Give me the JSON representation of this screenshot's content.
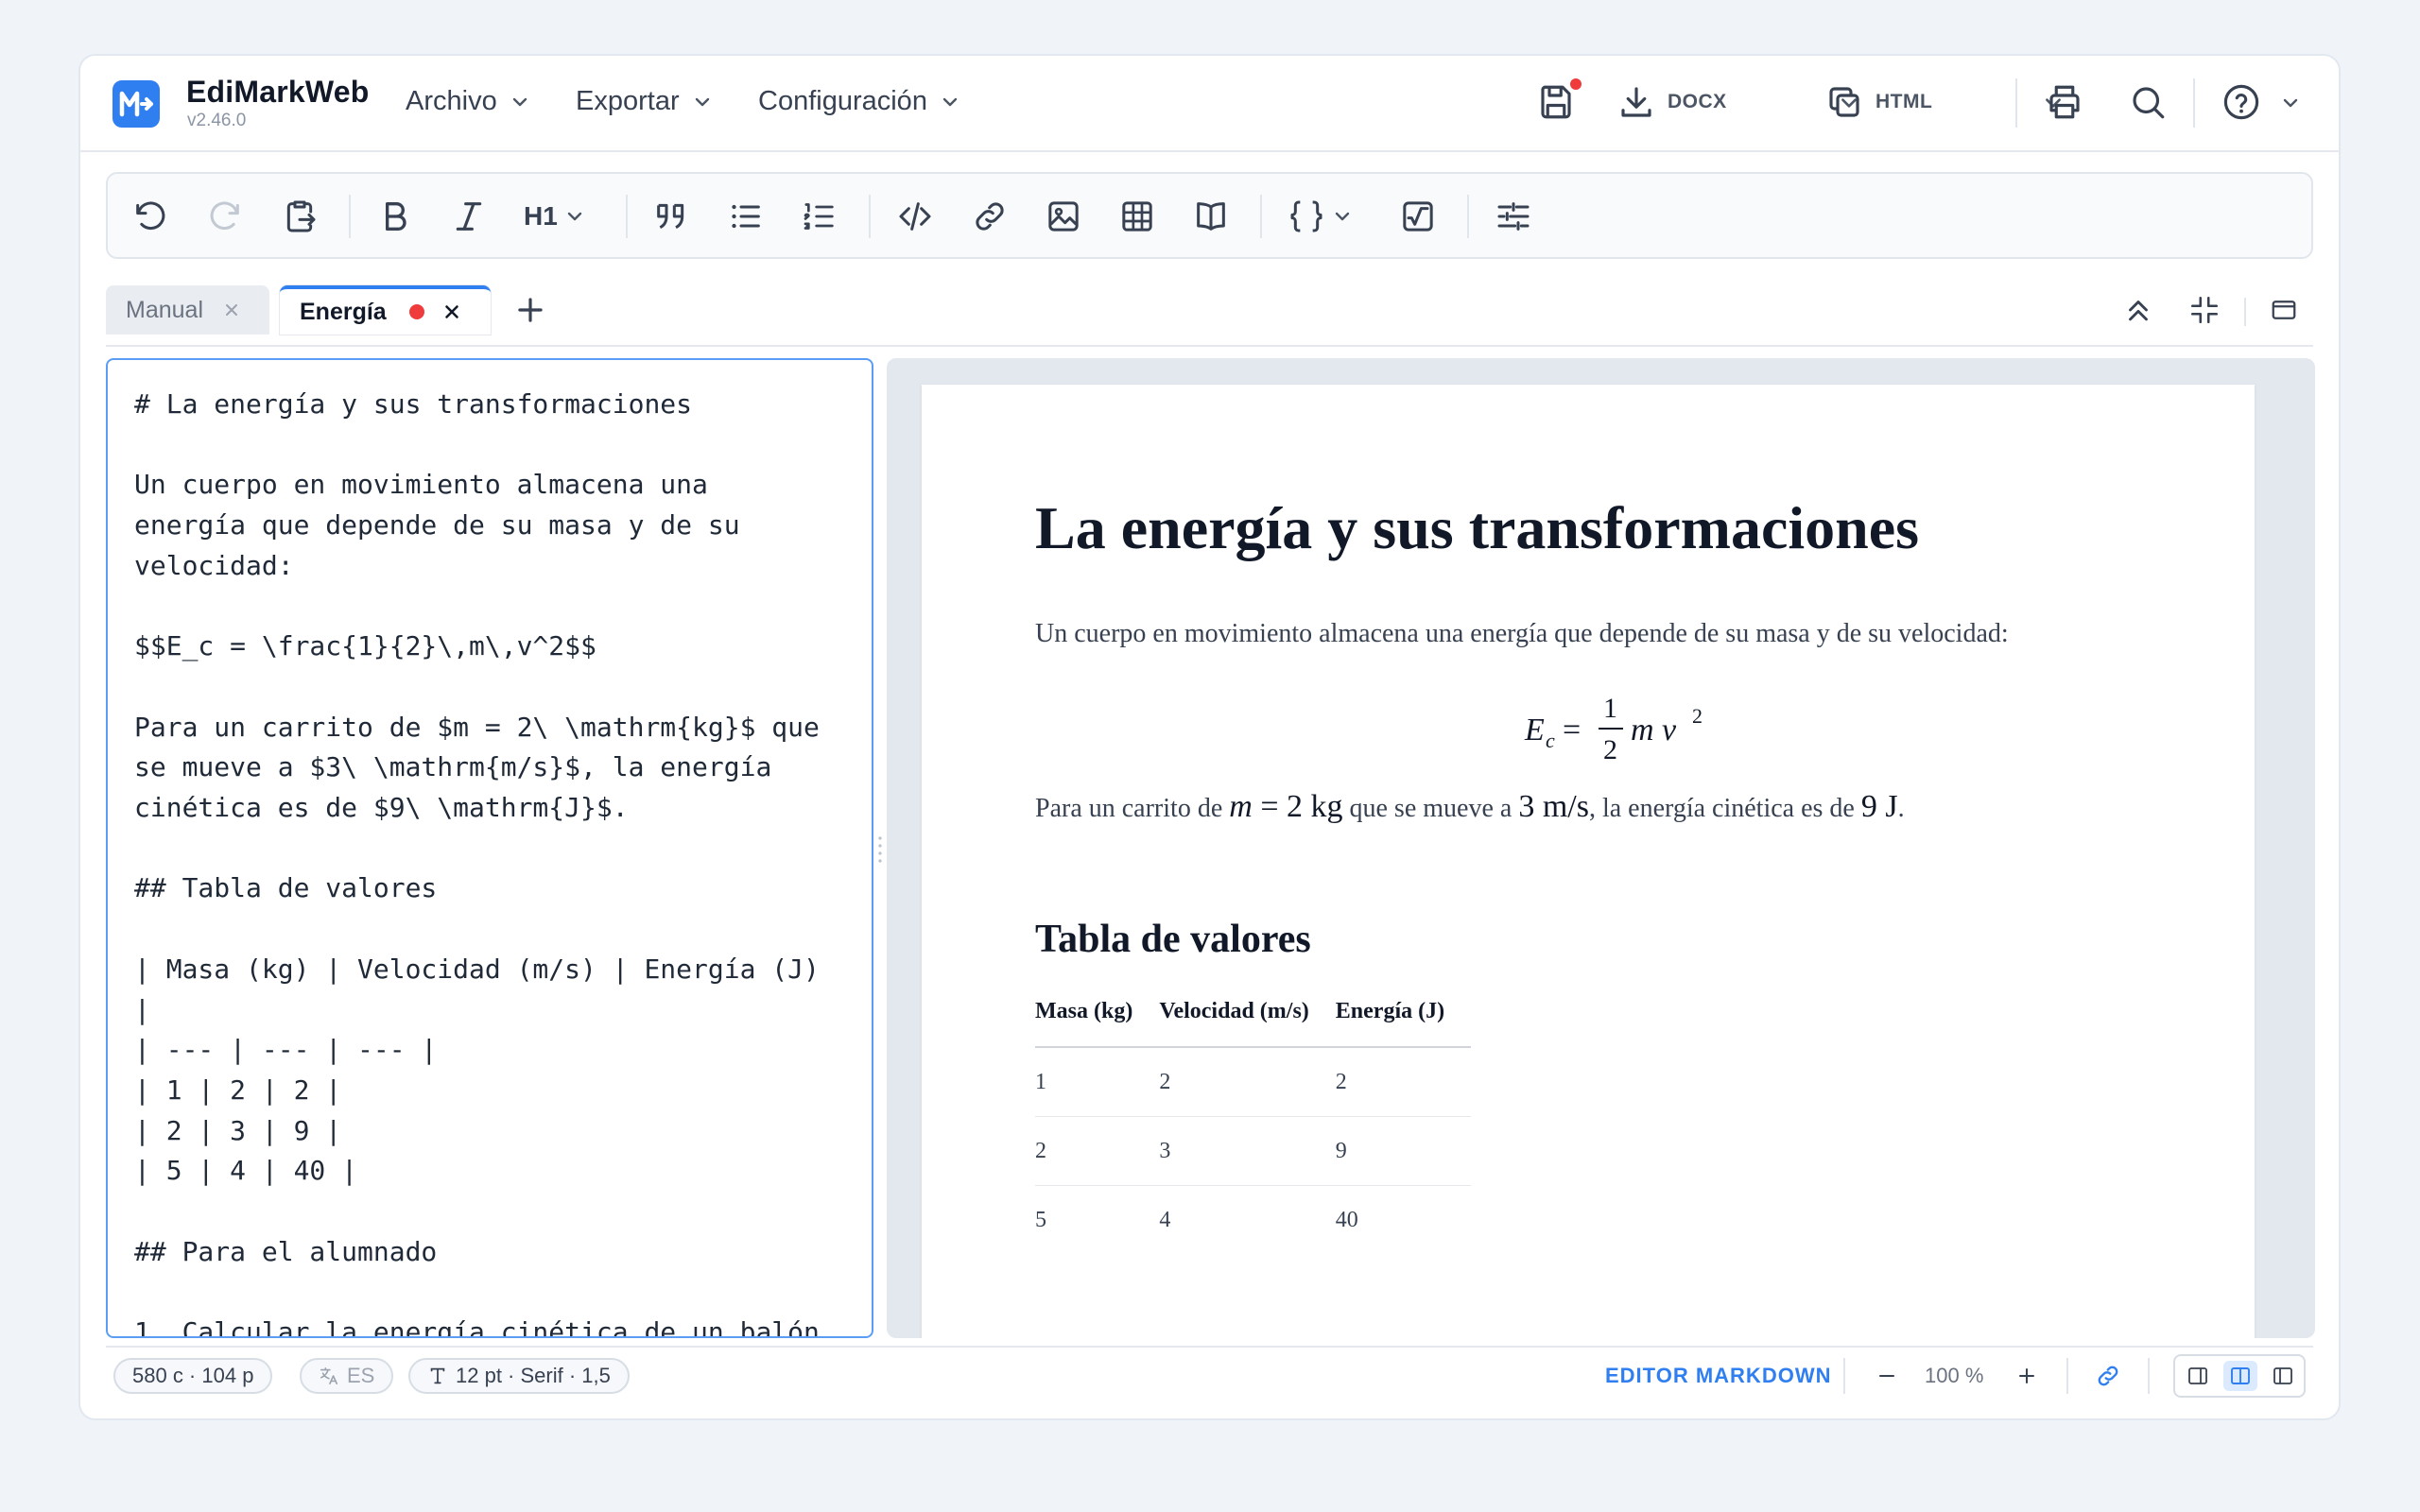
{
  "app": {
    "name": "EdiMarkWeb",
    "version": "v2.46.0"
  },
  "menu": {
    "file": "Archivo",
    "export": "Exportar",
    "settings": "Configuración"
  },
  "header_actions": {
    "docx_label": "DOCX",
    "html_label": "HTML"
  },
  "toolbar": {
    "heading_label": "H1"
  },
  "tabs": [
    {
      "label": "Manual",
      "active": false,
      "unsaved": false
    },
    {
      "label": "Energía",
      "active": true,
      "unsaved": true
    }
  ],
  "editor": {
    "content": "# La energía y sus transformaciones\n\nUn cuerpo en movimiento almacena una\nenergía que depende de su masa y de su\nvelocidad:\n\n$$E_c = \\frac{1}{2}\\,m\\,v^2$$\n\nPara un carrito de $m = 2\\ \\mathrm{kg}$ que\nse mueve a $3\\ \\mathrm{m/s}$, la energía\ncinética es de $9\\ \\mathrm{J}$.\n\n## Tabla de valores\n\n| Masa (kg) | Velocidad (m/s) | Energía (J)\n|\n| --- | --- | --- |\n| 1 | 2 | 2 |\n| 2 | 3 | 9 |\n| 5 | 4 | 40 |\n\n## Para el alumnado\n\n1. Calcular la energía cinética de un balón"
  },
  "preview": {
    "title": "La energía y sus transformaciones",
    "paragraph1": "Un cuerpo en movimiento almacena una energía que depende de su masa y de su velocidad:",
    "formula": {
      "lhs": "E",
      "sub": "c",
      "num": "1",
      "den": "2",
      "rhs": "m v",
      "exp": "2"
    },
    "paragraph2": {
      "p1": "Para un carrito de ",
      "m1_var": "m",
      "m1_rest": " = 2 kg",
      "p2": " que se mueve a ",
      "m2": "3 m/s",
      "p3": ", la energía cinética es de ",
      "m3": "9 J",
      "p4": "."
    },
    "subtitle": "Tabla de valores",
    "table": {
      "headers": [
        "Masa (kg)",
        "Velocidad (m/s)",
        "Energía (J)"
      ],
      "rows": [
        [
          "1",
          "2",
          "2"
        ],
        [
          "2",
          "3",
          "9"
        ],
        [
          "5",
          "4",
          "40"
        ]
      ]
    }
  },
  "status": {
    "counts": "580 c · 104 p",
    "language": "ES",
    "font": "12 pt · Serif · 1,5",
    "mode": "EDITOR MARKDOWN",
    "zoom": "100 %"
  },
  "colors": {
    "accent": "#2f7ff0",
    "unsaved_dot": "#ef3b3b",
    "background": "#f0f3f7"
  }
}
